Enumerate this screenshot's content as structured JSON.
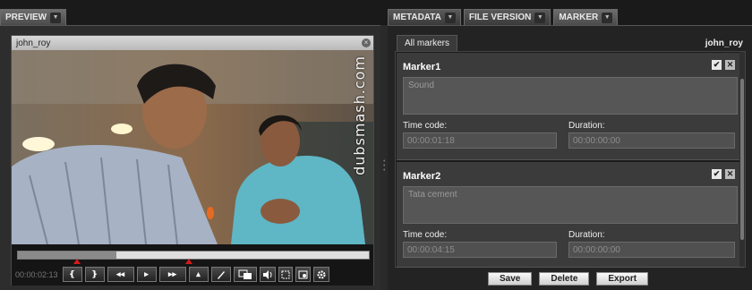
{
  "tabs": {
    "preview": "PREVIEW",
    "metadata": "METADATA",
    "file_version": "FILE VERSION",
    "marker": "MARKER"
  },
  "player": {
    "title": "john_roy",
    "watermark": "dubsmash.com",
    "timecode": "00:00:02:13",
    "progress_fraction": 0.28,
    "marker_positions": [
      0.17,
      0.49
    ],
    "buttons": {
      "mark_in": "❴",
      "mark_out": "❵",
      "rewind": "◂◂",
      "play": "▸",
      "forward": "▸▸",
      "up": "▴",
      "pen_icon": "pen-icon",
      "frame_icon": "frame-icon",
      "volume_icon": "volume-icon",
      "fullscreen_icon": "fullscreen-icon",
      "snapshot_icon": "snapshot-icon",
      "settings_icon": "gear-icon"
    }
  },
  "markers_panel": {
    "subtab": "All markers",
    "user": "john_roy",
    "time_code_label": "Time code:",
    "duration_label": "Duration:",
    "markers": [
      {
        "name": "Marker1",
        "note": "Sound",
        "time_code": "00:00:01:18",
        "duration": "00:00:00:00"
      },
      {
        "name": "Marker2",
        "note": "Tata cement",
        "time_code": "00:00:04:15",
        "duration": "00:00:00:00"
      }
    ],
    "actions": {
      "save": "Save",
      "delete": "Delete",
      "export": "Export"
    }
  }
}
